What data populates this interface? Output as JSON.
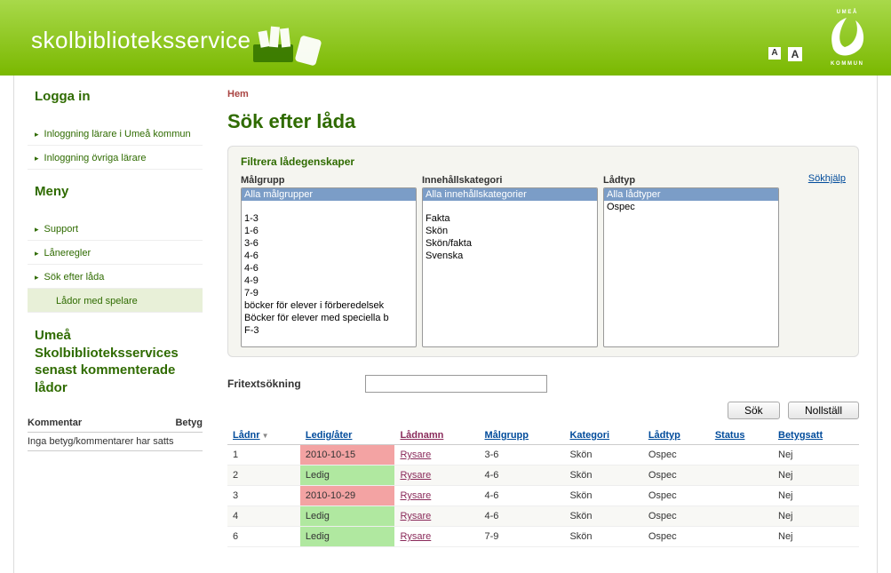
{
  "header": {
    "title": "skolbiblioteksservice",
    "font_small": "A",
    "font_large": "A",
    "kommun_text": "UMEÅ KOMMUN"
  },
  "sidebar": {
    "login_title": "Logga in",
    "login_items": [
      "Inloggning lärare i Umeå kommun",
      "Inloggning övriga lärare"
    ],
    "menu_title": "Meny",
    "menu_items": [
      "Support",
      "Låneregler",
      "Sök efter låda"
    ],
    "menu_sub": "Lådor med spelare",
    "recent_title": "Umeå Skolbiblioteksservices senast kommenterade lådor",
    "recent_headers": {
      "comment": "Kommentar",
      "rating": "Betyg"
    },
    "recent_none": "Inga betyg/kommentarer har satts"
  },
  "breadcrumb": {
    "home": "Hem"
  },
  "page_title": "Sök efter låda",
  "filter": {
    "title": "Filtrera lådegenskaper",
    "help": "Sökhjälp",
    "cols": {
      "malgrupp": {
        "label": "Målgrupp",
        "options": [
          "Alla målgrupper",
          "",
          "1-3",
          "1-6",
          "3-6",
          "4-6",
          "4-6",
          "4-9",
          "7-9",
          "böcker för elever i förberedelsek",
          "Böcker för elever med speciella b",
          "F-3"
        ]
      },
      "kategori": {
        "label": "Innehållskategori",
        "options": [
          "Alla innehållskategorier",
          "",
          "Fakta",
          "Skön",
          "Skön/fakta",
          "Svenska"
        ]
      },
      "ladtyp": {
        "label": "Lådtyp",
        "options": [
          "Alla lådtyper",
          "Ospec"
        ]
      }
    }
  },
  "freetext_label": "Fritextsökning",
  "freetext_value": "",
  "buttons": {
    "search": "Sök",
    "reset": "Nollställ"
  },
  "table": {
    "headers": {
      "ladnr": "Lådnr",
      "ledig": "Ledig/åter",
      "ladnamn": "Lådnamn",
      "malgrupp": "Målgrupp",
      "kategori": "Kategori",
      "ladtyp": "Lådtyp",
      "status": "Status",
      "betygsatt": "Betygsatt"
    },
    "rows": [
      {
        "ladnr": "1",
        "ledig": "2010-10-15",
        "ledig_cls": "busy",
        "ladnamn": "Rysare",
        "malgrupp": "3-6",
        "kategori": "Skön",
        "ladtyp": "Ospec",
        "status": "",
        "betygsatt": "Nej"
      },
      {
        "ladnr": "2",
        "ledig": "Ledig",
        "ledig_cls": "free",
        "ladnamn": "Rysare",
        "malgrupp": "4-6",
        "kategori": "Skön",
        "ladtyp": "Ospec",
        "status": "",
        "betygsatt": "Nej"
      },
      {
        "ladnr": "3",
        "ledig": "2010-10-29",
        "ledig_cls": "busy",
        "ladnamn": "Rysare",
        "malgrupp": "4-6",
        "kategori": "Skön",
        "ladtyp": "Ospec",
        "status": "",
        "betygsatt": "Nej"
      },
      {
        "ladnr": "4",
        "ledig": "Ledig",
        "ledig_cls": "free",
        "ladnamn": "Rysare",
        "malgrupp": "4-6",
        "kategori": "Skön",
        "ladtyp": "Ospec",
        "status": "",
        "betygsatt": "Nej"
      },
      {
        "ladnr": "6",
        "ledig": "Ledig",
        "ledig_cls": "free",
        "ladnamn": "Rysare",
        "malgrupp": "7-9",
        "kategori": "Skön",
        "ladtyp": "Ospec",
        "status": "",
        "betygsatt": "Nej"
      }
    ]
  }
}
